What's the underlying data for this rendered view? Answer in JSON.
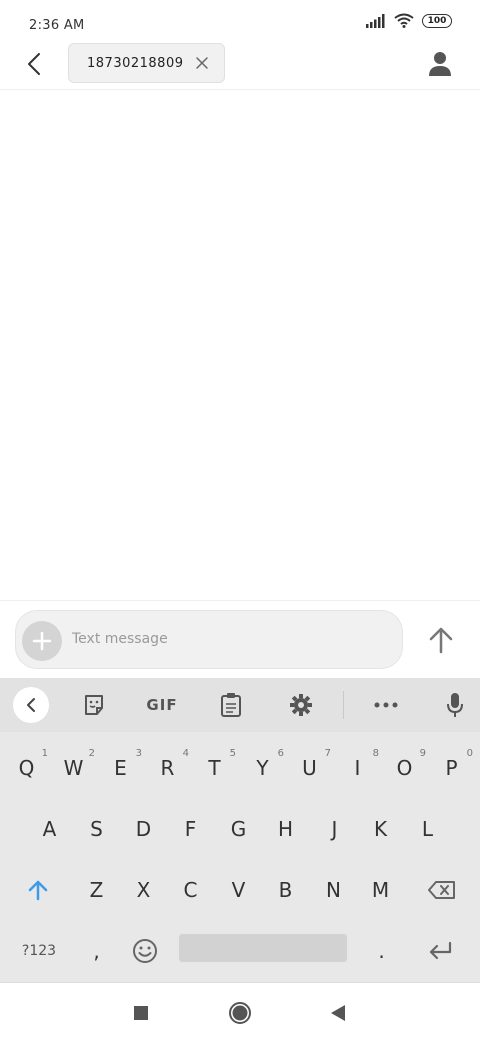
{
  "status_bar": {
    "time": "2:36 AM",
    "battery": "100",
    "icons": [
      "signal-icon",
      "wifi-icon",
      "battery-icon"
    ]
  },
  "header": {
    "recipient": "18730218809",
    "icons": [
      "back-arrow-icon",
      "close-icon",
      "contact-icon"
    ]
  },
  "compose": {
    "placeholder": "Text message",
    "value": "",
    "icons": [
      "plus-icon",
      "send-arrow-icon"
    ]
  },
  "keyboard": {
    "toolbar_icons": [
      "chevron-left-icon",
      "sticker-icon",
      "gif-icon",
      "clipboard-icon",
      "gear-icon",
      "more-icon",
      "mic-icon"
    ],
    "gif_label": "GIF",
    "row1": [
      {
        "key": "Q",
        "hint": "1"
      },
      {
        "key": "W",
        "hint": "2"
      },
      {
        "key": "E",
        "hint": "3"
      },
      {
        "key": "R",
        "hint": "4"
      },
      {
        "key": "T",
        "hint": "5"
      },
      {
        "key": "Y",
        "hint": "6"
      },
      {
        "key": "U",
        "hint": "7"
      },
      {
        "key": "I",
        "hint": "8"
      },
      {
        "key": "O",
        "hint": "9"
      },
      {
        "key": "P",
        "hint": "0"
      }
    ],
    "row2": [
      "A",
      "S",
      "D",
      "F",
      "G",
      "H",
      "J",
      "K",
      "L"
    ],
    "row3": [
      "Z",
      "X",
      "C",
      "V",
      "B",
      "N",
      "M"
    ],
    "row4": {
      "symbols": "?123",
      "comma": ",",
      "period": "."
    },
    "accent_color": "#3d9be9"
  },
  "nav_bar": {
    "icons": [
      "recents-square-icon",
      "home-circle-icon",
      "back-triangle-icon"
    ]
  }
}
